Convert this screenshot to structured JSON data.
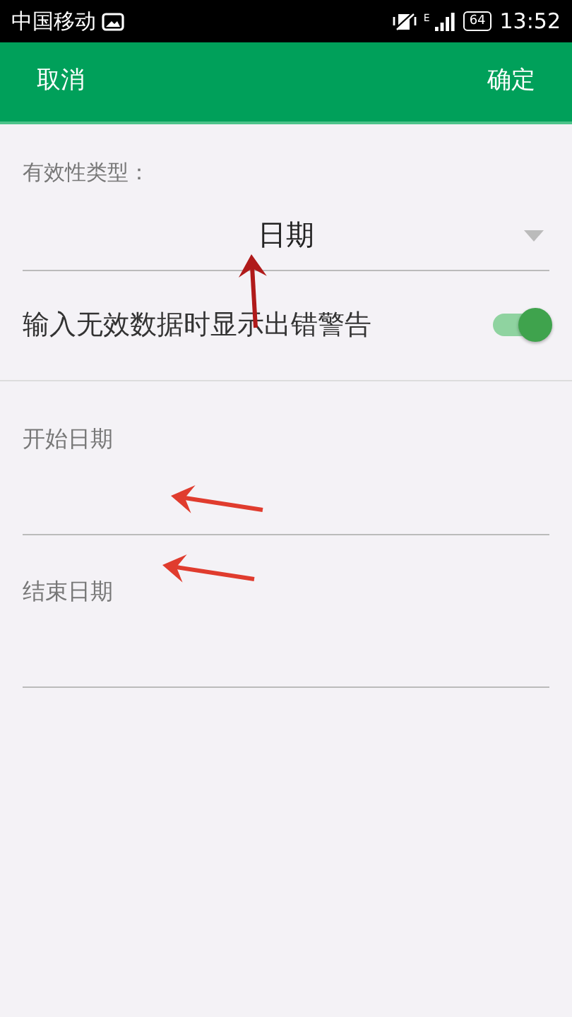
{
  "status_bar": {
    "carrier": "中国移动",
    "network": "E",
    "battery": "64",
    "time": "13:52"
  },
  "toolbar": {
    "cancel": "取消",
    "confirm": "确定"
  },
  "validity_type": {
    "label": "有效性类型：",
    "value": "日期"
  },
  "error_alert": {
    "label": "输入无效数据时显示出错警告",
    "on": true
  },
  "fields": [
    {
      "label": "开始日期"
    },
    {
      "label": "结束日期"
    }
  ]
}
